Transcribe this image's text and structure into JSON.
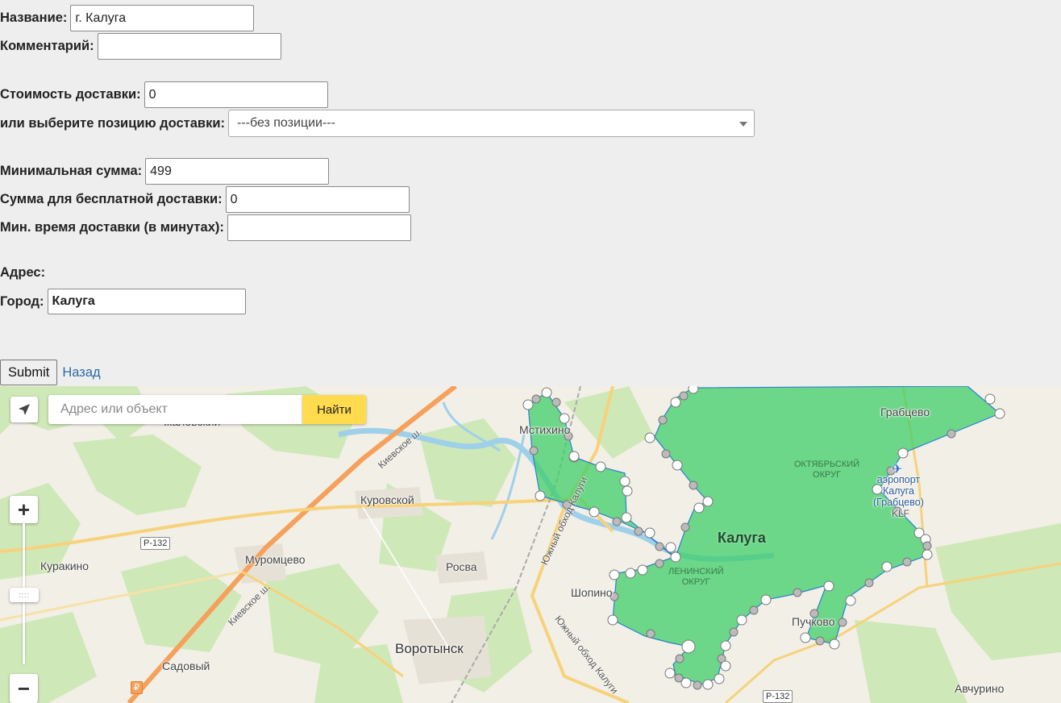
{
  "form": {
    "name": {
      "label": "Название:",
      "value": "г. Калуга"
    },
    "comment": {
      "label": "Комментарий:",
      "value": ""
    },
    "delivery_cost": {
      "label": "Стоимость доставки:",
      "value": "0"
    },
    "delivery_position": {
      "label": "или выберите позицию доставки:",
      "selected": "---без позиции---"
    },
    "min_sum": {
      "label": "Минимальная сумма:",
      "value": "499"
    },
    "free_delivery_sum": {
      "label": "Сумма для бесплатной доставки:",
      "value": "0"
    },
    "min_delivery_time": {
      "label": "Мин. время доставки (в минутах):",
      "value": ""
    },
    "address_label": "Адрес:",
    "city": {
      "label": "Город:",
      "value": "Калуга"
    },
    "submit_label": "Submit",
    "back_link": "Назад"
  },
  "map": {
    "search_placeholder": "Адрес или объект",
    "find_button": "Найти",
    "zoom_in": "+",
    "zoom_out": "−",
    "zone_color": "#3fcf6a",
    "places": {
      "kalugа_city": "Калуга",
      "grabtsevo": "Грабцево",
      "airport": "аэропорт\nКалуга\n(Грабцево)",
      "airport_code": "KLF",
      "oktyabrsky": "ОКТЯБРЬСКИЙ\nОКРУГ",
      "leninsky": "ЛЕНИНСКИЙ\nОКРУГ",
      "mstikhino": "Мстихино",
      "kurovskoy": "Куровской",
      "kurakino": "Куракино",
      "muromtsevo": "Муромцево",
      "rosva": "Росва",
      "vorotynsk": "Воротынск",
      "shopino": "Шопино",
      "puchkovo": "Пучково",
      "sadovy": "Садовый",
      "avchurino": "Авчурино",
      "ikalovsky": "Ікаловский",
      "kievskoe1": "Киевское ш.",
      "kievskoe2": "Киевское ш.",
      "yuzhny1": "Южный обход Калуги",
      "yuzhny2": "Южный обход Калуги",
      "r132_a": "Р-132",
      "r132_b": "Р-132",
      "ruble": "₽"
    }
  }
}
